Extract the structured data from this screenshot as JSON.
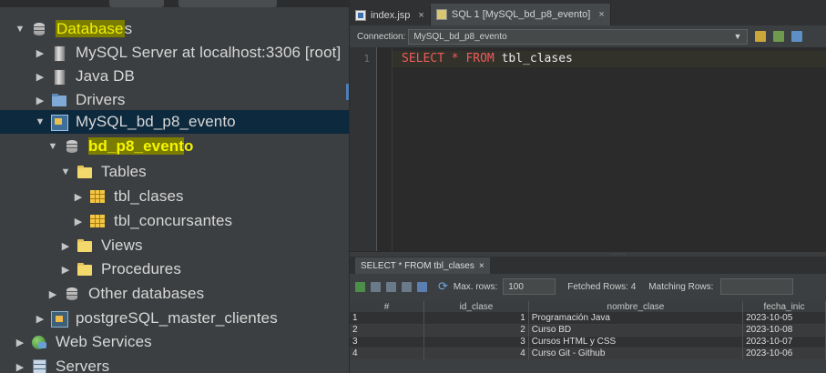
{
  "tree": {
    "items": [
      {
        "label_hl": "Database",
        "label_rest": "s",
        "expanded": true
      },
      {
        "label": "MySQL Server at localhost:3306 [root]"
      },
      {
        "label": "Java DB"
      },
      {
        "label": "Drivers"
      },
      {
        "label": "MySQL_bd_p8_evento",
        "selected": true
      },
      {
        "label_hl": "bd_p8_event",
        "label_rest": "o"
      },
      {
        "label": "Tables"
      },
      {
        "label": "tbl_clases"
      },
      {
        "label": "tbl_concursantes"
      },
      {
        "label": "Views"
      },
      {
        "label": "Procedures"
      },
      {
        "label": "Other databases"
      },
      {
        "label": "postgreSQL_master_clientes"
      },
      {
        "label": "Web Services"
      },
      {
        "label": "Servers"
      }
    ]
  },
  "editor": {
    "tabs": [
      {
        "label": "index.jsp",
        "close": "×"
      },
      {
        "label": "SQL 1 [MySQL_bd_p8_evento]",
        "close": "×"
      }
    ],
    "connection_label": "Connection:",
    "connection_value": "MySQL_bd_p8_evento",
    "line_number": "1",
    "code": {
      "kw1": "SELECT",
      "star": " * ",
      "kw2": "FROM",
      "table": " tbl_clases"
    }
  },
  "results": {
    "tab_label": "SELECT * FROM tbl_clases",
    "tab_close": "×",
    "max_rows_label": "Max. rows:",
    "max_rows_value": "100",
    "fetched_rows": "Fetched Rows: 4",
    "matching_rows_label": "Matching Rows:",
    "columns": [
      "#",
      "id_clase",
      "nombre_clase",
      "fecha_inic"
    ],
    "rows": [
      {
        "n": "1",
        "id": "1",
        "nombre": "Programación Java",
        "fecha": "2023-10-05"
      },
      {
        "n": "2",
        "id": "2",
        "nombre": "Curso BD",
        "fecha": "2023-10-08"
      },
      {
        "n": "3",
        "id": "3",
        "nombre": "Cursos HTML y CSS",
        "fecha": "2023-10-07"
      },
      {
        "n": "4",
        "id": "4",
        "nombre": "Curso Git - Github",
        "fecha": "2023-10-06"
      }
    ]
  },
  "colors": {
    "highlight_bg": "#7b7d00",
    "highlight_fg": "#f0f000",
    "selection_bg": "#0d293e",
    "sql_keyword": "#f15a5a"
  }
}
